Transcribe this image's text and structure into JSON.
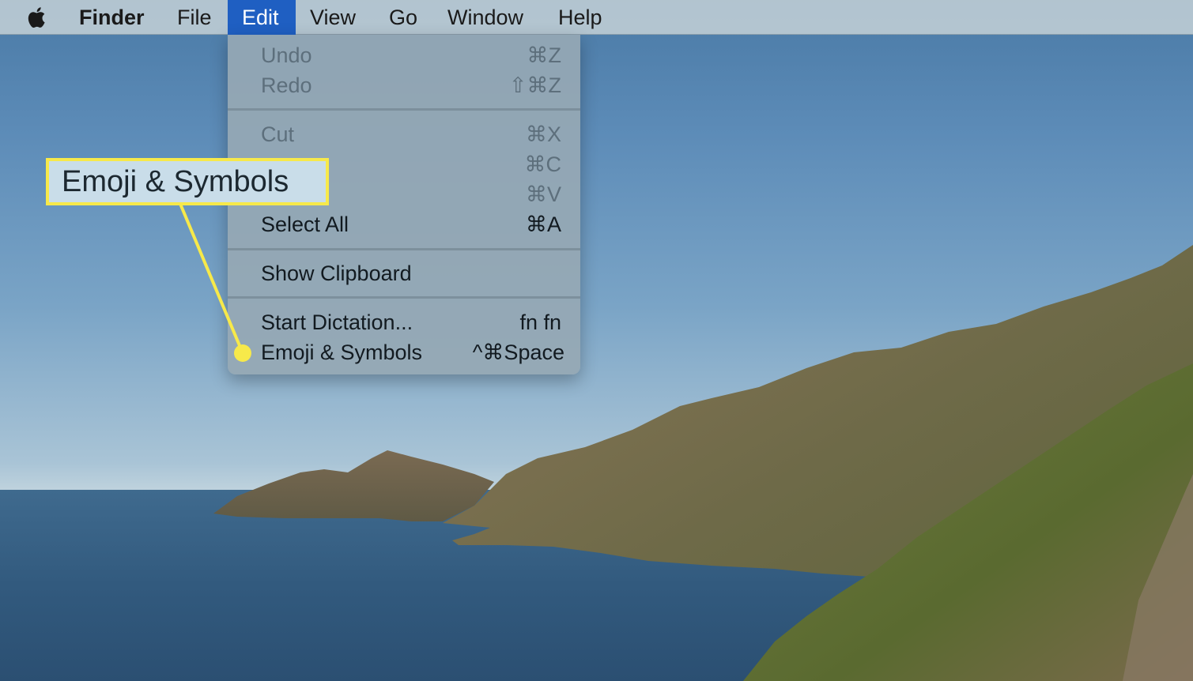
{
  "menubar": {
    "apple_icon": "apple-logo-icon",
    "app_name": "Finder",
    "items": [
      "File",
      "Edit",
      "View",
      "Go",
      "Window",
      "Help"
    ],
    "active_item": "Edit",
    "active_color": "#1f5fc2"
  },
  "edit_menu": {
    "undo": {
      "label": "Undo",
      "shortcut": "⌘Z"
    },
    "redo": {
      "label": "Redo",
      "shortcut": "⇧⌘Z"
    },
    "cut": {
      "label": "Cut",
      "shortcut": "⌘X"
    },
    "copy": {
      "shortcut": "⌘C"
    },
    "paste": {
      "shortcut": "⌘V"
    },
    "select_all": {
      "label": "Select All",
      "shortcut": "⌘A"
    },
    "show_clipboard": {
      "label": "Show Clipboard"
    },
    "start_dictation": {
      "label": "Start Dictation...",
      "shortcut": "fn fn"
    },
    "emoji_symbols": {
      "label": "Emoji & Symbols",
      "shortcut": "^⌘Space"
    }
  },
  "callout": {
    "text": "Emoji & Symbols",
    "color": "#f7e94a"
  }
}
